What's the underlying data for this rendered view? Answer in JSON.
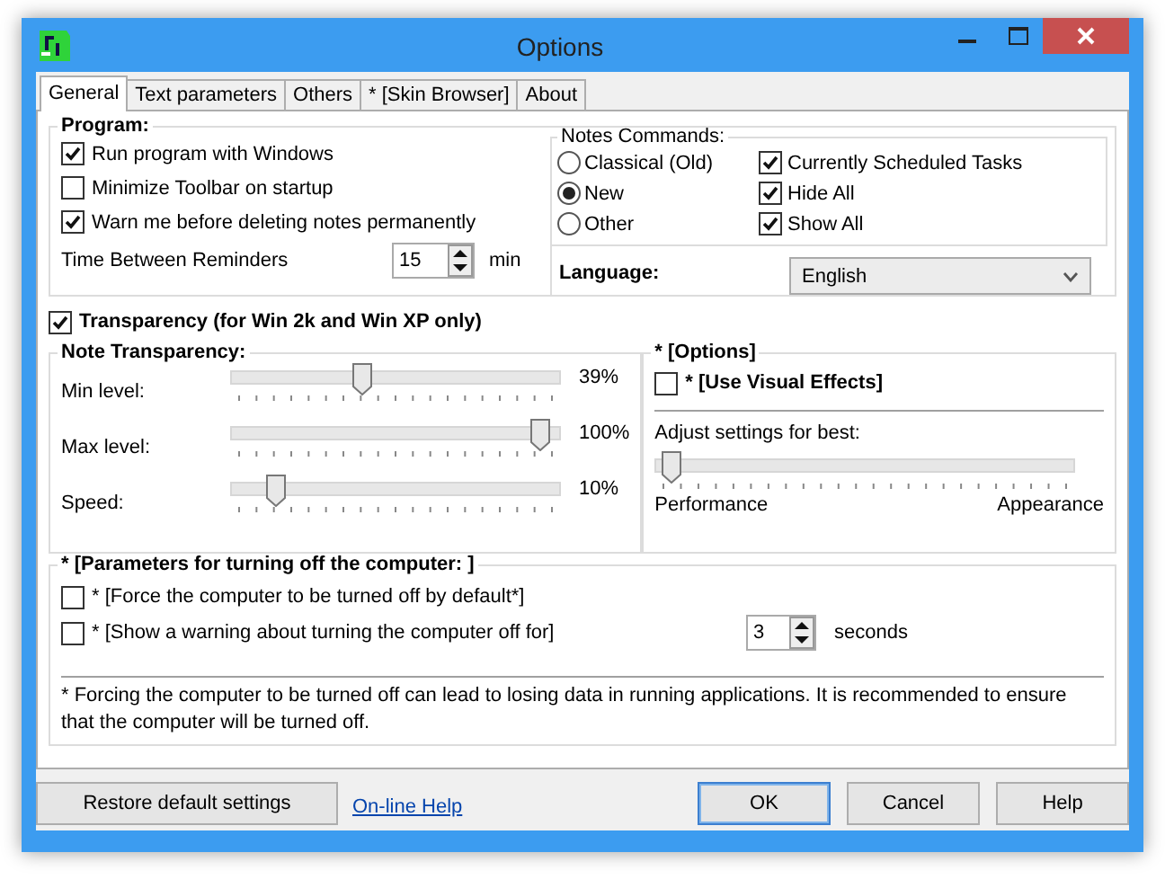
{
  "window": {
    "title": "Options"
  },
  "tabs": [
    {
      "label": "General",
      "selected": true
    },
    {
      "label": "Text parameters",
      "selected": false
    },
    {
      "label": "Others",
      "selected": false
    },
    {
      "label": "* [Skin Browser]",
      "selected": false
    },
    {
      "label": "About",
      "selected": false
    }
  ],
  "program": {
    "title": "Program:",
    "options": [
      {
        "label": "Run program with Windows",
        "checked": true
      },
      {
        "label": "Minimize Toolbar on startup",
        "checked": false
      },
      {
        "label": "Warn me before deleting notes permanently",
        "checked": true
      }
    ],
    "reminder": {
      "label": "Time Between Reminders",
      "value": "15",
      "unit": "min"
    }
  },
  "notes_commands": {
    "title": "Notes Commands:",
    "modes": [
      {
        "label": "Classical (Old)",
        "selected": false
      },
      {
        "label": "New",
        "selected": true
      },
      {
        "label": "Other",
        "selected": false
      }
    ],
    "commands": [
      {
        "label": "Currently Scheduled Tasks",
        "checked": true
      },
      {
        "label": "Hide All",
        "checked": true
      },
      {
        "label": "Show All",
        "checked": true
      }
    ]
  },
  "language": {
    "label": "Language:",
    "value": "English"
  },
  "transparency": {
    "label": "Transparency (for Win 2k and Win XP only)",
    "checked": true
  },
  "note_transparency": {
    "title": "Note Transparency:",
    "sliders": [
      {
        "label": "Min level:",
        "level": 0.39,
        "reading": "39%"
      },
      {
        "label": "Max level:",
        "level": 1,
        "reading": "100%"
      },
      {
        "label": "Speed:",
        "level": 0.1,
        "reading": "10%"
      }
    ]
  },
  "visual_options": {
    "title": "* [Options]",
    "effects": {
      "label": "* [Use Visual Effects]",
      "checked": false
    },
    "hint": "Adjust settings for best:",
    "level": 0,
    "min_label": "Performance",
    "max_label": "Appearance"
  },
  "shutdown": {
    "title": "* [Parameters for turning off the computer: ]",
    "options": [
      {
        "label": "* [Force the computer to be turned off by default*]",
        "checked": false
      },
      {
        "label": "* [Show a warning about turning the computer off for]",
        "checked": false
      }
    ],
    "delay": {
      "value": "3",
      "unit": "seconds"
    },
    "note": "* Forcing the computer to be turned off can lead to losing data in running applications. It is recommended to ensure that the computer will be turned off."
  },
  "footer": {
    "restore": "Restore default settings",
    "help_link": "On-line Help",
    "buttons": [
      "OK",
      "Cancel",
      "Help"
    ]
  }
}
